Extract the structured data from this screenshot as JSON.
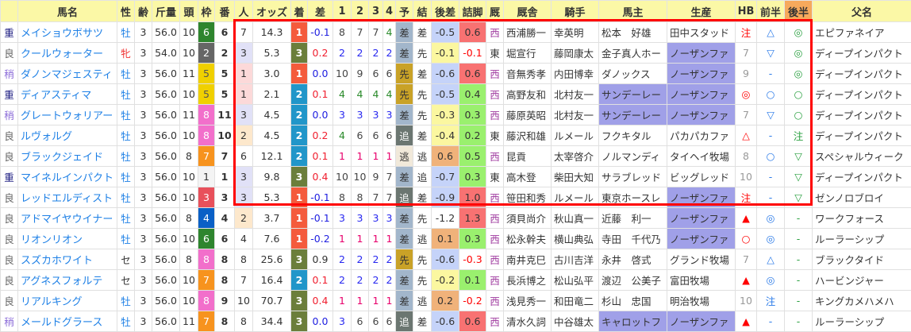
{
  "headers": [
    "",
    "馬名",
    "性",
    "齢",
    "斤量",
    "頭",
    "枠",
    "番",
    "人",
    "オッズ",
    "着",
    "差",
    "1",
    "2",
    "3",
    "4",
    "予",
    "結",
    "後差",
    "詰脚",
    "厩",
    "厩舎",
    "騎手",
    "馬主",
    "生産",
    "HB",
    "前半",
    "後半",
    "父名"
  ],
  "colors": {
    "header": "#fbf8a6",
    "header_accent": "#f6a95c",
    "highlight": "#a0a0e8",
    "box": "#ff0000",
    "chaku_1": "#f45b3c",
    "chaku_2": "#2196c9",
    "chaku_3": "#6b7e3b"
  },
  "rows": [
    [
      "重",
      "メイショウボサツ",
      "牡",
      "3",
      "56.0",
      "10",
      "6",
      "6",
      "7",
      "14.3",
      "1",
      "-0.1",
      "8",
      "7",
      "7",
      "4",
      "差",
      "差",
      "-0.5",
      "0.6",
      "西",
      "西浦勝一",
      "幸英明",
      "松本　好雄",
      "田中スタッド",
      "注",
      "△",
      "◎",
      "エピファネイア"
    ],
    [
      "良",
      "クールウォーター",
      "牝",
      "3",
      "54.0",
      "10",
      "2",
      "2",
      "3",
      "5.3",
      "3",
      "0.2",
      "2",
      "2",
      "2",
      "2",
      "差",
      "先",
      "-0.1",
      "-0.1",
      "東",
      "堀宣行",
      "藤岡康太",
      "金子真人ホー",
      "ノーザンファ",
      "7",
      "▽",
      "◎",
      "ディープインパクト"
    ],
    [
      "稍",
      "ダノンマジェスティ",
      "牡",
      "3",
      "56.0",
      "11",
      "5",
      "5",
      "1",
      "3.0",
      "1",
      "0.0",
      "10",
      "9",
      "6",
      "6",
      "先",
      "差",
      "-0.6",
      "0.6",
      "西",
      "音無秀孝",
      "内田博幸",
      "ダノックス",
      "ノーザンファ",
      "9",
      "-",
      "◎",
      "ディープインパクト"
    ],
    [
      "重",
      "ディアスティマ",
      "牡",
      "3",
      "56.0",
      "10",
      "5",
      "5",
      "1",
      "2.1",
      "2",
      "0.1",
      "4",
      "4",
      "4",
      "4",
      "先",
      "先",
      "-0.5",
      "0.4",
      "西",
      "高野友和",
      "北村友一",
      "サンデーレー",
      "ノーザンファ",
      "◎",
      "○",
      "○",
      "ディープインパクト"
    ],
    [
      "稍",
      "グレートウォリアー",
      "牡",
      "3",
      "56.0",
      "11",
      "8",
      "11",
      "3",
      "4.5",
      "2",
      "0.0",
      "3",
      "3",
      "3",
      "3",
      "差",
      "先",
      "-0.3",
      "0.3",
      "西",
      "藤原英昭",
      "北村友一",
      "サンデーレー",
      "ノーザンファ",
      "7",
      "▽",
      "○",
      "ディープインパクト"
    ],
    [
      "良",
      "ルヴォルグ",
      "牡",
      "3",
      "56.0",
      "10",
      "8",
      "10",
      "2",
      "4.5",
      "2",
      "0.2",
      "4",
      "6",
      "6",
      "6",
      "追",
      "差",
      "-0.4",
      "0.2",
      "東",
      "藤沢和雄",
      "ルメール",
      "フクキタル",
      "パカパカファ",
      "△",
      "-",
      "注",
      "ディープインパクト"
    ],
    [
      "良",
      "ブラックジェイド",
      "牡",
      "3",
      "56.0",
      "8",
      "7",
      "7",
      "6",
      "12.1",
      "2",
      "0.1",
      "1",
      "1",
      "1",
      "1",
      "逃",
      "逃",
      "0.6",
      "0.5",
      "西",
      "昆貢",
      "太宰啓介",
      "ノルマンディ",
      "タイヘイ牧場",
      "8",
      "○",
      "▽",
      "スペシャルウィーク"
    ],
    [
      "重",
      "マイネルインパクト",
      "牡",
      "3",
      "56.0",
      "10",
      "1",
      "1",
      "3",
      "9.8",
      "3",
      "0.4",
      "10",
      "10",
      "9",
      "7",
      "差",
      "追",
      "-0.7",
      "0.3",
      "東",
      "高木登",
      "柴田大知",
      "サラブレッド",
      "ビッグレッド",
      "10",
      "-",
      "▽",
      "ディープインパクト"
    ],
    [
      "良",
      "レッドエルディスト",
      "牡",
      "3",
      "56.0",
      "10",
      "3",
      "3",
      "3",
      "5.3",
      "1",
      "-0.1",
      "8",
      "8",
      "7",
      "7",
      "追",
      "差",
      "-0.9",
      "1.0",
      "西",
      "笹田和秀",
      "ルメール",
      "東京ホースレ",
      "ノーザンファ",
      "注",
      "-",
      "▽",
      "ゼンノロブロイ"
    ],
    [
      "良",
      "アドマイヤウイナー",
      "牡",
      "3",
      "56.0",
      "8",
      "4",
      "4",
      "2",
      "3.7",
      "1",
      "-0.1",
      "3",
      "3",
      "3",
      "3",
      "差",
      "先",
      "-1.2",
      "1.3",
      "西",
      "須貝尚介",
      "秋山真一",
      "近藤　利一",
      "ノーザンファ",
      "▲",
      "◎",
      "-",
      "ワークフォース"
    ],
    [
      "良",
      "リオンリオン",
      "牡",
      "3",
      "56.0",
      "10",
      "6",
      "6",
      "4",
      "7.6",
      "1",
      "-0.2",
      "1",
      "1",
      "1",
      "1",
      "差",
      "逃",
      "0.1",
      "0.3",
      "西",
      "松永幹夫",
      "横山典弘",
      "寺田　千代乃",
      "ノーザンファ",
      "○",
      "◎",
      "-",
      "ルーラーシップ"
    ],
    [
      "良",
      "スズカホワイト",
      "セ",
      "3",
      "56.0",
      "8",
      "8",
      "8",
      "8",
      "25.6",
      "3",
      "0.9",
      "2",
      "2",
      "2",
      "2",
      "先",
      "先",
      "-0.6",
      "-0.3",
      "西",
      "南井克巳",
      "古川吉洋",
      "永井　啓式",
      "グランド牧場",
      "7",
      "△",
      "-",
      "ブラックタイド"
    ],
    [
      "良",
      "アグネスフォルテ",
      "セ",
      "3",
      "56.0",
      "10",
      "7",
      "8",
      "7",
      "16.4",
      "2",
      "0.1",
      "2",
      "2",
      "2",
      "2",
      "差",
      "先",
      "-0.2",
      "0.1",
      "西",
      "長浜博之",
      "松山弘平",
      "渡辺　公美子",
      "富田牧場",
      "▲",
      "◎",
      "-",
      "ハービンジャー"
    ],
    [
      "良",
      "リアルキング",
      "牡",
      "3",
      "56.0",
      "10",
      "8",
      "9",
      "10",
      "70.7",
      "3",
      "0.4",
      "1",
      "1",
      "1",
      "1",
      "差",
      "逃",
      "0.2",
      "-0.2",
      "西",
      "浅見秀一",
      "和田竜二",
      "杉山　忠国",
      "明治牧場",
      "10",
      "注",
      "-",
      "キングカメハメハ"
    ],
    [
      "稍",
      "メールドグラース",
      "牡",
      "3",
      "56.0",
      "11",
      "7",
      "8",
      "8",
      "34.4",
      "3",
      "0.0",
      "3",
      "6",
      "6",
      "6",
      "追",
      "差",
      "-0.6",
      "0.6",
      "西",
      "清水久詞",
      "中谷雄太",
      "キャロットフ",
      "ノーザンファ",
      "▲",
      "-",
      "-",
      "ルーラーシップ"
    ]
  ],
  "owner_highlight_rows": [
    3,
    4,
    14
  ]
}
